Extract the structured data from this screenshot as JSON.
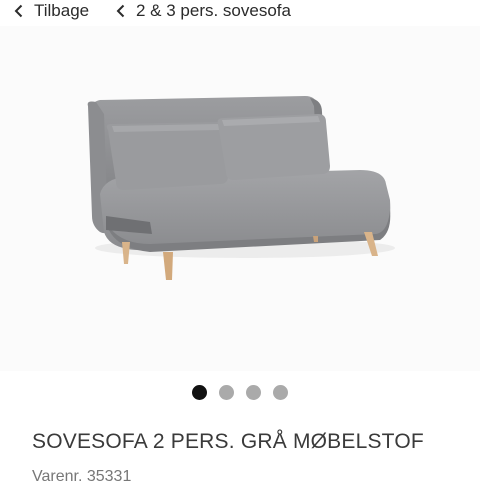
{
  "nav": {
    "back_label": "Tilbage",
    "breadcrumb_label": "2 & 3 pers. sovesofa"
  },
  "gallery": {
    "image_alt": "Grå sovesofa",
    "slide_count": 4,
    "active_slide": 1
  },
  "product": {
    "title": "SOVESOFA 2 PERS. GRÅ MØBELSTOF",
    "sku_text": "Varenr. 35331"
  },
  "colors": {
    "fabric": "#8f9093",
    "leg_wood": "#d9b48a",
    "active_dot": "#111111",
    "inactive_dot": "#aaaaaa"
  }
}
